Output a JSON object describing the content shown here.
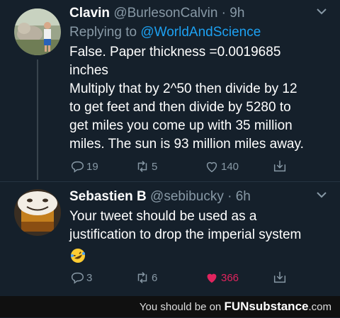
{
  "tweets": [
    {
      "name": "Clavin",
      "handle": "@BurlesonCalvin",
      "time": "· 9h",
      "reply_prefix": "Replying to",
      "reply_to": "@WorldAndScience",
      "lines": [
        "False. Paper thickness =0.0019685",
        "inches",
        "Multiply that by 2^50 then divide by 12",
        "to get feet and then divide by 5280 to",
        "get miles you come up with 35 million",
        "miles. The sun is 93 million miles away."
      ],
      "replies": "19",
      "retweets": "5",
      "likes": "140"
    },
    {
      "name": "Sebastien B",
      "handle": "@sebibucky",
      "time": "· 6h",
      "lines": [
        "Your tweet should be used as a",
        "justification to drop the imperial system"
      ],
      "replies": "3",
      "retweets": "6",
      "likes": "366"
    }
  ],
  "footer": {
    "prefix": "You should be on",
    "brand": "FUNsubstance",
    "suffix": ".com"
  },
  "colors": {
    "background": "#15202b",
    "link": "#1da1f2",
    "like_active": "#e0245e",
    "muted": "#8899a6"
  },
  "icons": [
    "reply-icon",
    "retweet-icon",
    "like-icon",
    "share-icon",
    "chevron-down-icon",
    "rofl-emoji-icon"
  ]
}
